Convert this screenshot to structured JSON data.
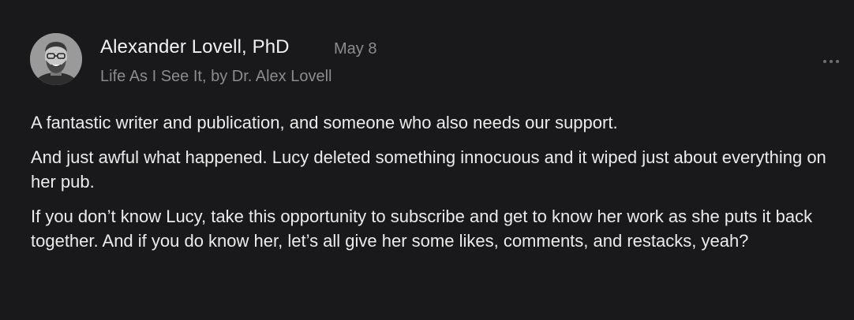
{
  "note": {
    "author": {
      "name": "Alexander Lovell, PhD",
      "avatar_icon": "author-avatar-photo"
    },
    "date": "May 8",
    "publication": "Life As I See It, by Dr. Alex Lovell",
    "more_icon": "ellipsis-icon",
    "paragraphs": [
      "A fantastic writer and publication, and someone who also needs our support.",
      "And just awful what happened. Lucy deleted something innocuous and it wiped just about everything on her pub.",
      "If you don’t know Lucy, take this opportunity to subscribe and get to know her work as she puts it back together. And if you do know her, let’s all give her some likes, comments, and restacks, yeah?"
    ]
  },
  "colors": {
    "background": "#19181a",
    "text_primary": "#f2f2f2",
    "text_secondary": "#8c8c8c"
  }
}
